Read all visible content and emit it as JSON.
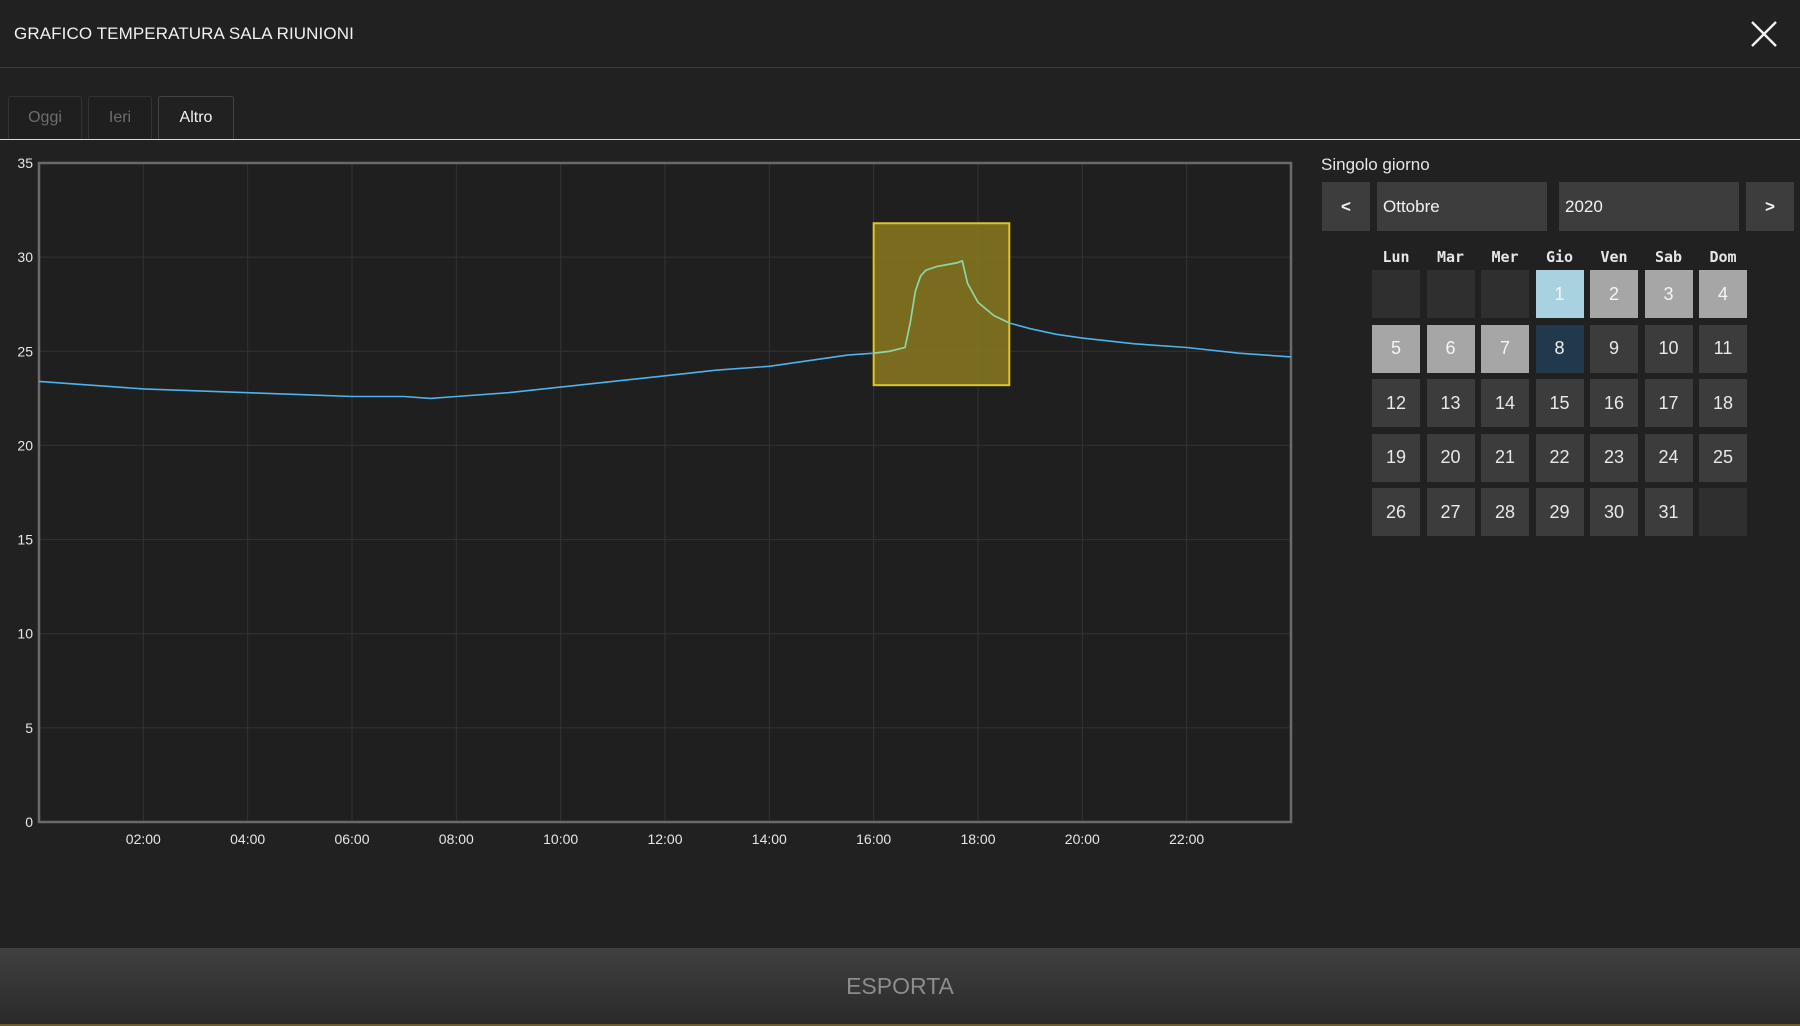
{
  "header": {
    "title": "GRAFICO TEMPERATURA SALA RIUNIONI",
    "close_icon": "close-icon"
  },
  "tabs": [
    {
      "label": "Oggi",
      "active": false
    },
    {
      "label": "Ieri",
      "active": false
    },
    {
      "label": "Altro",
      "active": true
    }
  ],
  "calendar": {
    "title": "Singolo giorno",
    "prev_label": "<",
    "next_label": ">",
    "month": "Ottobre",
    "year": "2020",
    "weekdays": [
      "Lun",
      "Mar",
      "Mer",
      "Gio",
      "Ven",
      "Sab",
      "Dom"
    ],
    "days": [
      {
        "label": "",
        "state": "empty"
      },
      {
        "label": "",
        "state": "empty"
      },
      {
        "label": "",
        "state": "empty"
      },
      {
        "label": "1",
        "state": "first"
      },
      {
        "label": "2",
        "state": "hl"
      },
      {
        "label": "3",
        "state": "hl"
      },
      {
        "label": "4",
        "state": "hl"
      },
      {
        "label": "5",
        "state": "hl"
      },
      {
        "label": "6",
        "state": "hl"
      },
      {
        "label": "7",
        "state": "hl"
      },
      {
        "label": "8",
        "state": "sel"
      },
      {
        "label": "9",
        "state": "normal"
      },
      {
        "label": "10",
        "state": "normal"
      },
      {
        "label": "11",
        "state": "normal"
      },
      {
        "label": "12",
        "state": "normal"
      },
      {
        "label": "13",
        "state": "normal"
      },
      {
        "label": "14",
        "state": "normal"
      },
      {
        "label": "15",
        "state": "normal"
      },
      {
        "label": "16",
        "state": "normal"
      },
      {
        "label": "17",
        "state": "normal"
      },
      {
        "label": "18",
        "state": "normal"
      },
      {
        "label": "19",
        "state": "normal"
      },
      {
        "label": "20",
        "state": "normal"
      },
      {
        "label": "21",
        "state": "normal"
      },
      {
        "label": "22",
        "state": "normal"
      },
      {
        "label": "23",
        "state": "normal"
      },
      {
        "label": "24",
        "state": "normal"
      },
      {
        "label": "25",
        "state": "normal"
      },
      {
        "label": "26",
        "state": "normal"
      },
      {
        "label": "27",
        "state": "normal"
      },
      {
        "label": "28",
        "state": "normal"
      },
      {
        "label": "29",
        "state": "normal"
      },
      {
        "label": "30",
        "state": "normal"
      },
      {
        "label": "31",
        "state": "normal"
      },
      {
        "label": "",
        "state": "empty"
      }
    ]
  },
  "footer": {
    "export_label": "ESPORTA"
  },
  "colors": {
    "line": "#4db3ea",
    "highlight_fill": "#8a7a1e",
    "highlight_border": "#e0c42a",
    "highlight_line": "#9ad39a"
  },
  "chart_data": {
    "type": "line",
    "title": "",
    "xlabel": "",
    "ylabel": "",
    "ylim": [
      0,
      35
    ],
    "xlim": [
      0,
      24
    ],
    "grid": true,
    "yticks": [
      0,
      5,
      10,
      15,
      20,
      25,
      30,
      35
    ],
    "xticks": [
      "02:00",
      "04:00",
      "06:00",
      "08:00",
      "10:00",
      "12:00",
      "14:00",
      "16:00",
      "18:00",
      "20:00",
      "22:00"
    ],
    "highlight": {
      "x": [
        16.0,
        18.6
      ],
      "y": [
        23.2,
        31.8
      ]
    },
    "series": [
      {
        "x": [
          0,
          0.5,
          1,
          2,
          3,
          4,
          5,
          6,
          7,
          7.5,
          8,
          9,
          10,
          11,
          12,
          13,
          14,
          15,
          15.5,
          16,
          16.3,
          16.6,
          16.7,
          16.8,
          16.9,
          17.0,
          17.2,
          17.4,
          17.6,
          17.7,
          17.8,
          18.0,
          18.3,
          18.6,
          19,
          19.5,
          20,
          21,
          22,
          23,
          24
        ],
        "values": [
          23.4,
          23.3,
          23.2,
          23.0,
          22.9,
          22.8,
          22.7,
          22.6,
          22.6,
          22.5,
          22.6,
          22.8,
          23.1,
          23.4,
          23.7,
          24.0,
          24.2,
          24.6,
          24.8,
          24.9,
          25.0,
          25.2,
          26.5,
          28.2,
          29.0,
          29.3,
          29.5,
          29.6,
          29.7,
          29.8,
          28.6,
          27.6,
          26.9,
          26.5,
          26.2,
          25.9,
          25.7,
          25.4,
          25.2,
          24.9,
          24.7
        ]
      }
    ]
  }
}
